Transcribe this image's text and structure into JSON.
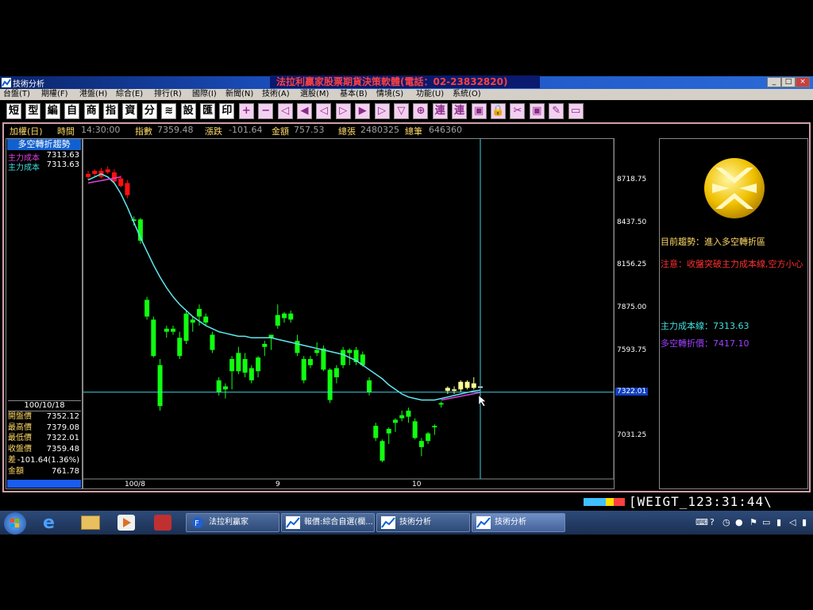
{
  "window": {
    "title": "技術分析",
    "ad": "法拉利贏家股票期貨決策軟體(電話：02-23832820)",
    "controls": [
      "_",
      "□",
      "×"
    ]
  },
  "menu": [
    "台盤(T)",
    "期權(F)",
    "港盤(H)",
    "綜合(E)",
    "排行(R)",
    "國際(I)",
    "新聞(N)",
    "技術(A)",
    "選股(M)",
    "基本(B)",
    "情境(S)",
    "功能(U)",
    "系統(O)"
  ],
  "toolbar": [
    "短",
    "型",
    "編",
    "自",
    "商",
    "指",
    "資",
    "分",
    "≋",
    "設",
    "匯",
    "印",
    "+",
    "−",
    "◁",
    "◀",
    "◁",
    "▷",
    "▶",
    "▷",
    "▽",
    "⊕",
    "連",
    "連",
    "▣",
    "🔒",
    "✂",
    "▣",
    "✎",
    "▭"
  ],
  "infobar": {
    "name": "加權(日)",
    "time_label": "時間",
    "time_value": "14:30:00",
    "index_label": "指數",
    "index_value": "7359.48",
    "change_label": "漲跌",
    "change_value": "-101.64",
    "amount_label": "金額",
    "amount_value": "757.53",
    "vol_label": "總張",
    "vol_value": "2480325",
    "count_label": "總筆",
    "count_value": "646360"
  },
  "left_panel": {
    "title": "多空轉折趨勢",
    "legend": [
      {
        "label": "主力成本",
        "value": "7313.63",
        "color": "#e040e0"
      },
      {
        "label": "主力成本",
        "value": "7313.63",
        "color": "#40e0e0"
      }
    ],
    "date": "100/10/18",
    "quote": [
      {
        "label": "開盤價",
        "value": "7352.12"
      },
      {
        "label": "最高價",
        "value": "7379.08"
      },
      {
        "label": "最低價",
        "value": "7322.01"
      },
      {
        "label": "收盤價",
        "value": "7359.48"
      },
      {
        "label": "差",
        "value": "-101.64(1.36%)"
      },
      {
        "label": "金額",
        "value": "761.78"
      }
    ]
  },
  "chart_data": {
    "type": "candlestick",
    "y_ticks": [
      "8718.75",
      "8437.50",
      "8156.25",
      "7875.00",
      "7593.75",
      "7322.01",
      "7031.25"
    ],
    "y_tick_values": [
      8718.75,
      8437.5,
      8156.25,
      7875.0,
      7593.75,
      7322.01,
      7031.25
    ],
    "crosshair_value": "7322.01",
    "x_labels": [
      "100/8",
      "9",
      "10"
    ],
    "ylim": [
      6750,
      8990
    ],
    "candles": [
      {
        "o": 8740,
        "h": 8780,
        "l": 8720,
        "c": 8760,
        "color": "red"
      },
      {
        "o": 8760,
        "h": 8790,
        "l": 8740,
        "c": 8780,
        "color": "red"
      },
      {
        "o": 8780,
        "h": 8800,
        "l": 8730,
        "c": 8740,
        "color": "red"
      },
      {
        "o": 8790,
        "h": 8810,
        "l": 8760,
        "c": 8770,
        "color": "red"
      },
      {
        "o": 8770,
        "h": 8790,
        "l": 8700,
        "c": 8710,
        "color": "red"
      },
      {
        "o": 8730,
        "h": 8750,
        "l": 8670,
        "c": 8680,
        "color": "red"
      },
      {
        "o": 8700,
        "h": 8720,
        "l": 8600,
        "c": 8620,
        "color": "red"
      },
      {
        "o": 8450,
        "h": 8480,
        "l": 8420,
        "c": 8460,
        "color": "green"
      },
      {
        "o": 8460,
        "h": 8470,
        "l": 8300,
        "c": 8320,
        "color": "green"
      },
      {
        "o": 7930,
        "h": 7950,
        "l": 7800,
        "c": 7820,
        "color": "green"
      },
      {
        "o": 7800,
        "h": 7820,
        "l": 7550,
        "c": 7560,
        "color": "green"
      },
      {
        "o": 7500,
        "h": 7540,
        "l": 7200,
        "c": 7230,
        "color": "green"
      },
      {
        "o": 7720,
        "h": 7760,
        "l": 7680,
        "c": 7740,
        "color": "green"
      },
      {
        "o": 7740,
        "h": 7760,
        "l": 7700,
        "c": 7720,
        "color": "green"
      },
      {
        "o": 7680,
        "h": 7720,
        "l": 7540,
        "c": 7560,
        "color": "green"
      },
      {
        "o": 7840,
        "h": 7860,
        "l": 7640,
        "c": 7660,
        "color": "green"
      },
      {
        "o": 7780,
        "h": 7820,
        "l": 7720,
        "c": 7800,
        "color": "green"
      },
      {
        "o": 7820,
        "h": 7900,
        "l": 7760,
        "c": 7870,
        "color": "green"
      },
      {
        "o": 7820,
        "h": 7840,
        "l": 7760,
        "c": 7780,
        "color": "green"
      },
      {
        "o": 7700,
        "h": 7720,
        "l": 7580,
        "c": 7600,
        "color": "green"
      },
      {
        "o": 7400,
        "h": 7420,
        "l": 7300,
        "c": 7320,
        "color": "green"
      },
      {
        "o": 7360,
        "h": 7380,
        "l": 7280,
        "c": 7340,
        "color": "green"
      },
      {
        "o": 7460,
        "h": 7560,
        "l": 7340,
        "c": 7540,
        "color": "green"
      },
      {
        "o": 7580,
        "h": 7620,
        "l": 7440,
        "c": 7460,
        "color": "green"
      },
      {
        "o": 7540,
        "h": 7580,
        "l": 7420,
        "c": 7450,
        "color": "green"
      },
      {
        "o": 7480,
        "h": 7500,
        "l": 7380,
        "c": 7400,
        "color": "green"
      },
      {
        "o": 7460,
        "h": 7560,
        "l": 7420,
        "c": 7550,
        "color": "green"
      },
      {
        "o": 7620,
        "h": 7660,
        "l": 7560,
        "c": 7640,
        "color": "green"
      },
      {
        "o": 7680,
        "h": 7700,
        "l": 7600,
        "c": 7700,
        "color": "green"
      },
      {
        "o": 7760,
        "h": 7900,
        "l": 7740,
        "c": 7830,
        "color": "green"
      },
      {
        "o": 7810,
        "h": 7850,
        "l": 7780,
        "c": 7840,
        "color": "green"
      },
      {
        "o": 7840,
        "h": 7860,
        "l": 7780,
        "c": 7800,
        "color": "green"
      },
      {
        "o": 7660,
        "h": 7700,
        "l": 7560,
        "c": 7580,
        "color": "green"
      },
      {
        "o": 7540,
        "h": 7560,
        "l": 7380,
        "c": 7400,
        "color": "green"
      },
      {
        "o": 7500,
        "h": 7560,
        "l": 7480,
        "c": 7540,
        "color": "green"
      },
      {
        "o": 7600,
        "h": 7650,
        "l": 7560,
        "c": 7580,
        "color": "green"
      },
      {
        "o": 7610,
        "h": 7630,
        "l": 7460,
        "c": 7470,
        "color": "green"
      },
      {
        "o": 7470,
        "h": 7480,
        "l": 7250,
        "c": 7270,
        "color": "green"
      },
      {
        "o": 7480,
        "h": 7500,
        "l": 7380,
        "c": 7420,
        "color": "green"
      },
      {
        "o": 7600,
        "h": 7620,
        "l": 7480,
        "c": 7500,
        "color": "green"
      },
      {
        "o": 7580,
        "h": 7610,
        "l": 7500,
        "c": 7600,
        "color": "green"
      },
      {
        "o": 7600,
        "h": 7620,
        "l": 7500,
        "c": 7520,
        "color": "green"
      },
      {
        "o": 7570,
        "h": 7590,
        "l": 7490,
        "c": 7500,
        "color": "green"
      },
      {
        "o": 7400,
        "h": 7420,
        "l": 7300,
        "c": 7320,
        "color": "green"
      },
      {
        "o": 7100,
        "h": 7120,
        "l": 7000,
        "c": 7020,
        "color": "green"
      },
      {
        "o": 7000,
        "h": 7010,
        "l": 6860,
        "c": 6870,
        "color": "green"
      },
      {
        "o": 7050,
        "h": 7090,
        "l": 6980,
        "c": 7080,
        "color": "green"
      },
      {
        "o": 7120,
        "h": 7150,
        "l": 7060,
        "c": 7140,
        "color": "green"
      },
      {
        "o": 7150,
        "h": 7200,
        "l": 7130,
        "c": 7170,
        "color": "green"
      },
      {
        "o": 7160,
        "h": 7220,
        "l": 7120,
        "c": 7200,
        "color": "green"
      },
      {
        "o": 7130,
        "h": 7150,
        "l": 7010,
        "c": 7020,
        "color": "green"
      },
      {
        "o": 7000,
        "h": 7020,
        "l": 6900,
        "c": 6960,
        "color": "green"
      },
      {
        "o": 7000,
        "h": 7060,
        "l": 6980,
        "c": 7050,
        "color": "green"
      },
      {
        "o": 7090,
        "h": 7110,
        "l": 7040,
        "c": 7100,
        "color": "green"
      },
      {
        "o": 7240,
        "h": 7260,
        "l": 7220,
        "c": 7250,
        "color": "green"
      },
      {
        "o": 7330,
        "h": 7360,
        "l": 7310,
        "c": 7350,
        "color": "yellow"
      },
      {
        "o": 7330,
        "h": 7360,
        "l": 7310,
        "c": 7340,
        "color": "yellow"
      },
      {
        "o": 7340,
        "h": 7400,
        "l": 7320,
        "c": 7390,
        "color": "yellow"
      },
      {
        "o": 7350,
        "h": 7400,
        "l": 7340,
        "c": 7390,
        "color": "yellow"
      },
      {
        "o": 7380,
        "h": 7420,
        "l": 7340,
        "c": 7350,
        "color": "yellow"
      },
      {
        "o": 7352,
        "h": 7379,
        "l": 7322,
        "c": 7359,
        "color": "white"
      }
    ],
    "cost_line": [
      8720,
      8740,
      8760,
      8740,
      8700,
      8630,
      8540,
      8440,
      8340,
      8250,
      8160,
      8080,
      8010,
      7950,
      7900,
      7860,
      7820,
      7790,
      7760,
      7740,
      7720,
      7710,
      7700,
      7690,
      7690,
      7680,
      7680,
      7680,
      7680,
      7670,
      7660,
      7650,
      7640,
      7630,
      7620,
      7610,
      7600,
      7590,
      7580,
      7570,
      7550,
      7530,
      7500,
      7470,
      7440,
      7410,
      7370,
      7340,
      7310,
      7290,
      7280,
      7270,
      7270,
      7270,
      7280,
      7290,
      7300,
      7310,
      7320,
      7330,
      7335
    ],
    "pink_line": [
      {
        "i": 0,
        "v": 8700
      },
      {
        "i": 5,
        "v": 8740
      }
    ],
    "pink_line2": [
      {
        "i": 54,
        "v": 7270
      },
      {
        "i": 60,
        "v": 7320
      }
    ]
  },
  "right_panel": {
    "trend_label": "目前趨勢：進入多空轉折區",
    "notice": "注意：收盤突破主力成本線,空方小心",
    "cost_line_label": "主力成本線：7313.63",
    "turn_price_label": "多空轉折價：7417.10"
  },
  "status": {
    "ticker": "[WEIGT_123:31:44\\"
  },
  "taskbar": {
    "items": [
      "法拉利贏家",
      "報價:綜合自選(欄...",
      "技術分析",
      "技術分析"
    ]
  }
}
